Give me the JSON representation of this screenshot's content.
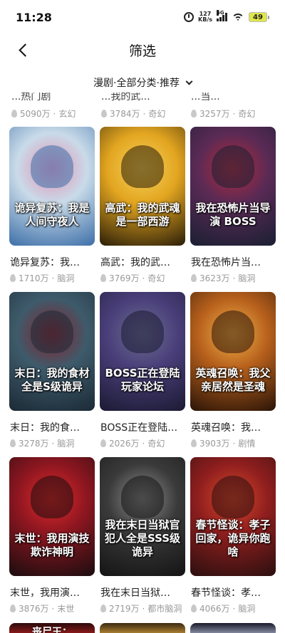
{
  "status_bar": {
    "time": "11:28",
    "net_speed_value": "127",
    "net_speed_unit": "KB/s",
    "signal_label": "5G",
    "battery": "49"
  },
  "header": {
    "title": "筛选",
    "back_icon": "chevron-left-icon"
  },
  "filter": {
    "text": "漫剧·全部分类·推荐",
    "icon": "chevron-down-icon"
  },
  "previous_row": [
    {
      "title": "...热门剧",
      "heat": "5090万",
      "genre": "玄幻"
    },
    {
      "title": "...我的武...",
      "heat": "3784万",
      "genre": "奇幻"
    },
    {
      "title": "...当...",
      "heat": "3257万",
      "genre": "奇幻"
    }
  ],
  "cards": [
    {
      "title": "诡异复苏：我…",
      "heat": "1710万",
      "genre": "脑洞",
      "cover_text": "诡异复苏：我是人间守夜人",
      "colors": [
        "#3d6fa8",
        "#c9dbe9",
        "#e38fb3"
      ]
    },
    {
      "title": "高武：我的武…",
      "heat": "3769万",
      "genre": "奇幻",
      "cover_text": "高武：我的武魂是一部西游",
      "colors": [
        "#2a1e08",
        "#e2a520",
        "#f7d35c"
      ]
    },
    {
      "title": "我在恐怖片当…",
      "heat": "3623万",
      "genre": "脑洞",
      "cover_text": "我在恐怖片当导演 BOSS",
      "colors": [
        "#1a1f33",
        "#5a2a55",
        "#b32a3a"
      ]
    },
    {
      "title": "末日：我的食…",
      "heat": "3278万",
      "genre": "脑洞",
      "cover_text": "末日：我的食材全是S级诡异",
      "colors": [
        "#1c2a36",
        "#3e5b6b",
        "#8a1f2c"
      ]
    },
    {
      "title": "BOSS正在登陆…",
      "heat": "2026万",
      "genre": "奇幻",
      "cover_text": "BOSS正在登陆玩家论坛",
      "colors": [
        "#1c1a33",
        "#4a3f7a",
        "#6a6f8f"
      ]
    },
    {
      "title": "英魂召唤：我…",
      "heat": "3903万",
      "genre": "剧情",
      "cover_text": "英魂召唤：我父亲居然是圣魂",
      "colors": [
        "#2a1407",
        "#b7601c",
        "#f1b24a"
      ]
    },
    {
      "title": "末世，我用演…",
      "heat": "3876万",
      "genre": "末世",
      "cover_text": "末世：我用演技欺诈神明",
      "colors": [
        "#1a0d0f",
        "#8c1620",
        "#e32a2a"
      ]
    },
    {
      "title": "我在末日当狱…",
      "heat": "2719万",
      "genre": "都市脑洞",
      "cover_text": "我在末日当狱官 犯人全是SSS级诡异",
      "colors": [
        "#141414",
        "#3a3a3a",
        "#8f8f8f"
      ]
    },
    {
      "title": "春节怪谈：孝…",
      "heat": "4066万",
      "genre": "脑洞",
      "cover_text": "春节怪谈：孝子回家，诡异你跑啥",
      "colors": [
        "#2b0f0f",
        "#8f1e1e",
        "#d84a2a"
      ]
    }
  ],
  "next_row_colors": [
    [
      "#2a0a0a",
      "#b32020"
    ],
    [
      "#3a2a10",
      "#d8a040"
    ],
    [
      "#1a1a2a",
      "#b0b8d0"
    ]
  ],
  "next_row_cover_text": "丧尸王："
}
